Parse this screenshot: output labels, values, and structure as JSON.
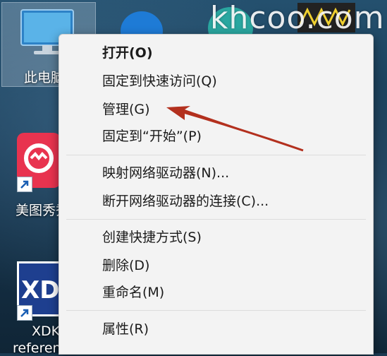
{
  "desktop": {
    "icons": [
      {
        "label": "此电脑",
        "icon": "monitor-icon"
      },
      {
        "label": "美图秀秀",
        "icon": "meitu-icon"
      },
      {
        "label": "XDK",
        "sublabel": "reference",
        "icon": "xdk-icon"
      }
    ],
    "watermark": "khcoo.com"
  },
  "context_menu": {
    "items": [
      {
        "label": "打开(O)",
        "bold": true
      },
      {
        "label": "固定到快速访问(Q)"
      },
      {
        "label": "管理(G)",
        "highlighted_by_arrow": true
      },
      {
        "label": "固定到“开始”(P)"
      },
      {
        "label": "映射网络驱动器(N)..."
      },
      {
        "label": "断开网络驱动器的连接(C)..."
      },
      {
        "label": "创建快捷方式(S)"
      },
      {
        "label": "删除(D)"
      },
      {
        "label": "重命名(M)"
      },
      {
        "label": "属性(R)"
      }
    ]
  },
  "annotation": {
    "arrow_color": "#b3301e",
    "points_to": "管理(G)"
  }
}
